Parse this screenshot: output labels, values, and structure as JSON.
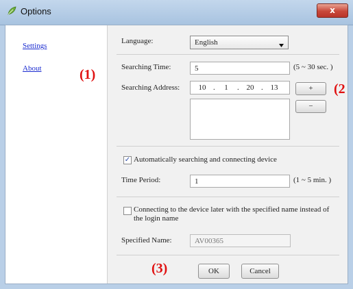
{
  "window": {
    "title": "Options",
    "close_label": "x"
  },
  "sidebar": {
    "items": [
      {
        "label": "Settings"
      },
      {
        "label": "About"
      }
    ]
  },
  "annotations": {
    "one": "(1)",
    "two": "(2",
    "three": "(3)"
  },
  "settings": {
    "language_label": "Language:",
    "language_value": "English",
    "searching_time_label": "Searching Time:",
    "searching_time_value": "5",
    "searching_time_range": "(5 ~ 30 sec. )",
    "searching_address_label": "Searching Address:",
    "ip": [
      "10",
      "1",
      "20",
      "13"
    ],
    "add_label": "+",
    "remove_label": "−",
    "auto_search_label": "Automatically searching and connecting device",
    "auto_search_checked": true,
    "time_period_label": "Time Period:",
    "time_period_value": "1",
    "time_period_range": "(1 ~ 5 min. )",
    "connect_later_label": "Connecting to the device later with the specified name instead of the login name",
    "connect_later_checked": false,
    "specified_name_label": "Specified Name:",
    "specified_name_value": "AV00365"
  },
  "footer": {
    "ok_label": "OK",
    "cancel_label": "Cancel"
  },
  "colors": {
    "annotation": "#e01010",
    "link": "#1a2bd0",
    "close_button": "#c8483a"
  },
  "icons": {
    "title_icon": "options-leaf-icon",
    "dropdown": "chevron-down-icon",
    "check": "check-icon"
  }
}
